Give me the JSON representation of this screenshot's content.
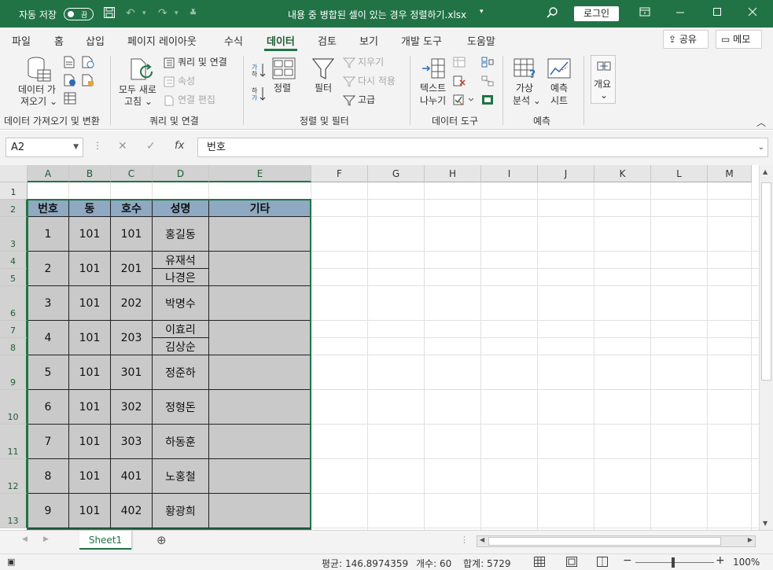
{
  "titlebar": {
    "autosave": "자동 저장",
    "toggle": "끔",
    "filename": "내용 중 병합된 셀이 있는 경우 정렬하기.xlsx",
    "login": "로그인"
  },
  "tabs": [
    "파일",
    "홈",
    "삽입",
    "페이지 레이아웃",
    "수식",
    "데이터",
    "검토",
    "보기",
    "개발 도구",
    "도움말"
  ],
  "active_tab": "데이터",
  "share": "공유",
  "memo": "메모",
  "ribbon": {
    "get_data_1": "데이터 가",
    "get_data_2": "져오기",
    "refresh_1": "모두 새로",
    "refresh_2": "고침",
    "queries": "쿼리 및 연결",
    "properties": "속성",
    "edit_links": "연결 편집",
    "sort": "정렬",
    "filter": "필터",
    "clear": "지우기",
    "reapply": "다시 적용",
    "advanced": "고급",
    "text_cols_1": "텍스트",
    "text_cols_2": "나누기",
    "whatif_1": "가상",
    "whatif_2": "분석",
    "forecast_1": "예측",
    "forecast_2": "시트",
    "outline": "개요",
    "groups": {
      "get": "데이터 가져오기 및 변환",
      "query": "쿼리 및 연결",
      "sortfilter": "정렬 및 필터",
      "tools": "데이터 도구",
      "forecast": "예측"
    }
  },
  "formula": {
    "namebox": "A2",
    "value": "번호"
  },
  "columns": [
    "A",
    "B",
    "C",
    "D",
    "E",
    "F",
    "G",
    "H",
    "I",
    "J",
    "K",
    "L",
    "M"
  ],
  "rows": [
    "1",
    "2",
    "3",
    "4",
    "5",
    "6",
    "7",
    "8",
    "9",
    "10",
    "11",
    "12",
    "13"
  ],
  "table": {
    "headers": [
      "번호",
      "동",
      "호수",
      "성명",
      "기타"
    ],
    "records": [
      {
        "no": "1",
        "dong": "101",
        "ho": "101",
        "names": [
          "홍길동"
        ]
      },
      {
        "no": "2",
        "dong": "101",
        "ho": "201",
        "names": [
          "유재석",
          "나경은"
        ]
      },
      {
        "no": "3",
        "dong": "101",
        "ho": "202",
        "names": [
          "박명수"
        ]
      },
      {
        "no": "4",
        "dong": "101",
        "ho": "203",
        "names": [
          "이효리",
          "김상순"
        ]
      },
      {
        "no": "5",
        "dong": "101",
        "ho": "301",
        "names": [
          "정준하"
        ]
      },
      {
        "no": "6",
        "dong": "101",
        "ho": "302",
        "names": [
          "정형돈"
        ]
      },
      {
        "no": "7",
        "dong": "101",
        "ho": "303",
        "names": [
          "하동훈"
        ]
      },
      {
        "no": "8",
        "dong": "101",
        "ho": "401",
        "names": [
          "노홍철"
        ]
      },
      {
        "no": "9",
        "dong": "101",
        "ho": "402",
        "names": [
          "황광희"
        ]
      }
    ]
  },
  "sheet": "Sheet1",
  "status": {
    "average": "평균: 146.8974359",
    "count": "개수: 60",
    "sum": "합계: 5729",
    "zoom": "100%"
  },
  "colors": {
    "accent": "#217346",
    "header_fill": "#8ea9c1",
    "data_fill": "#c9c9c9"
  }
}
